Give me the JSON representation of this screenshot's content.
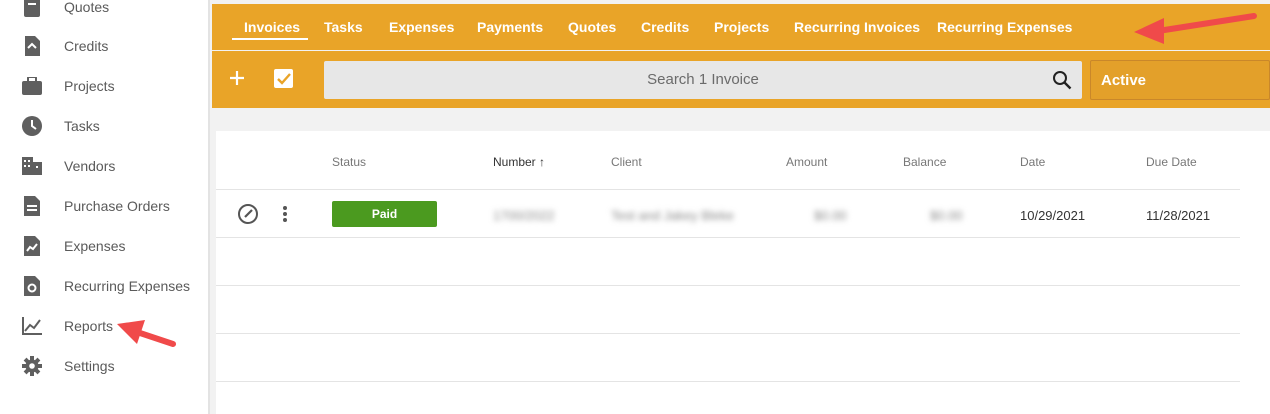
{
  "sidebar": {
    "items": [
      {
        "label": "Quotes",
        "icon": "quote-icon"
      },
      {
        "label": "Credits",
        "icon": "credit-icon"
      },
      {
        "label": "Projects",
        "icon": "briefcase-icon"
      },
      {
        "label": "Tasks",
        "icon": "clock-icon"
      },
      {
        "label": "Vendors",
        "icon": "building-icon"
      },
      {
        "label": "Purchase Orders",
        "icon": "document-icon"
      },
      {
        "label": "Expenses",
        "icon": "expense-icon"
      },
      {
        "label": "Recurring Expenses",
        "icon": "recurring-icon"
      },
      {
        "label": "Reports",
        "icon": "chart-line-icon"
      },
      {
        "label": "Settings",
        "icon": "gear-icon"
      }
    ]
  },
  "tabs": [
    {
      "label": "Invoices"
    },
    {
      "label": "Tasks"
    },
    {
      "label": "Expenses"
    },
    {
      "label": "Payments"
    },
    {
      "label": "Quotes"
    },
    {
      "label": "Credits"
    },
    {
      "label": "Projects"
    },
    {
      "label": "Recurring Invoices"
    },
    {
      "label": "Recurring Expenses"
    }
  ],
  "toolbar": {
    "search_placeholder": "Search 1 Invoice",
    "status_filter": "Active"
  },
  "table": {
    "columns": [
      "Status",
      "Number",
      "Client",
      "Amount",
      "Balance",
      "Date",
      "Due Date"
    ],
    "sort_indicator": "↑",
    "rows": [
      {
        "status": "Paid",
        "number": "1700/2022",
        "client": "Test and Jakey Bleke",
        "amount": "$0.00",
        "balance": "$0.00",
        "date": "10/29/2021",
        "due_date": "11/28/2021"
      }
    ]
  },
  "colors": {
    "accent": "#e9a428",
    "paid": "#4b9a1f",
    "annotation_arrow": "#f04a4a"
  }
}
